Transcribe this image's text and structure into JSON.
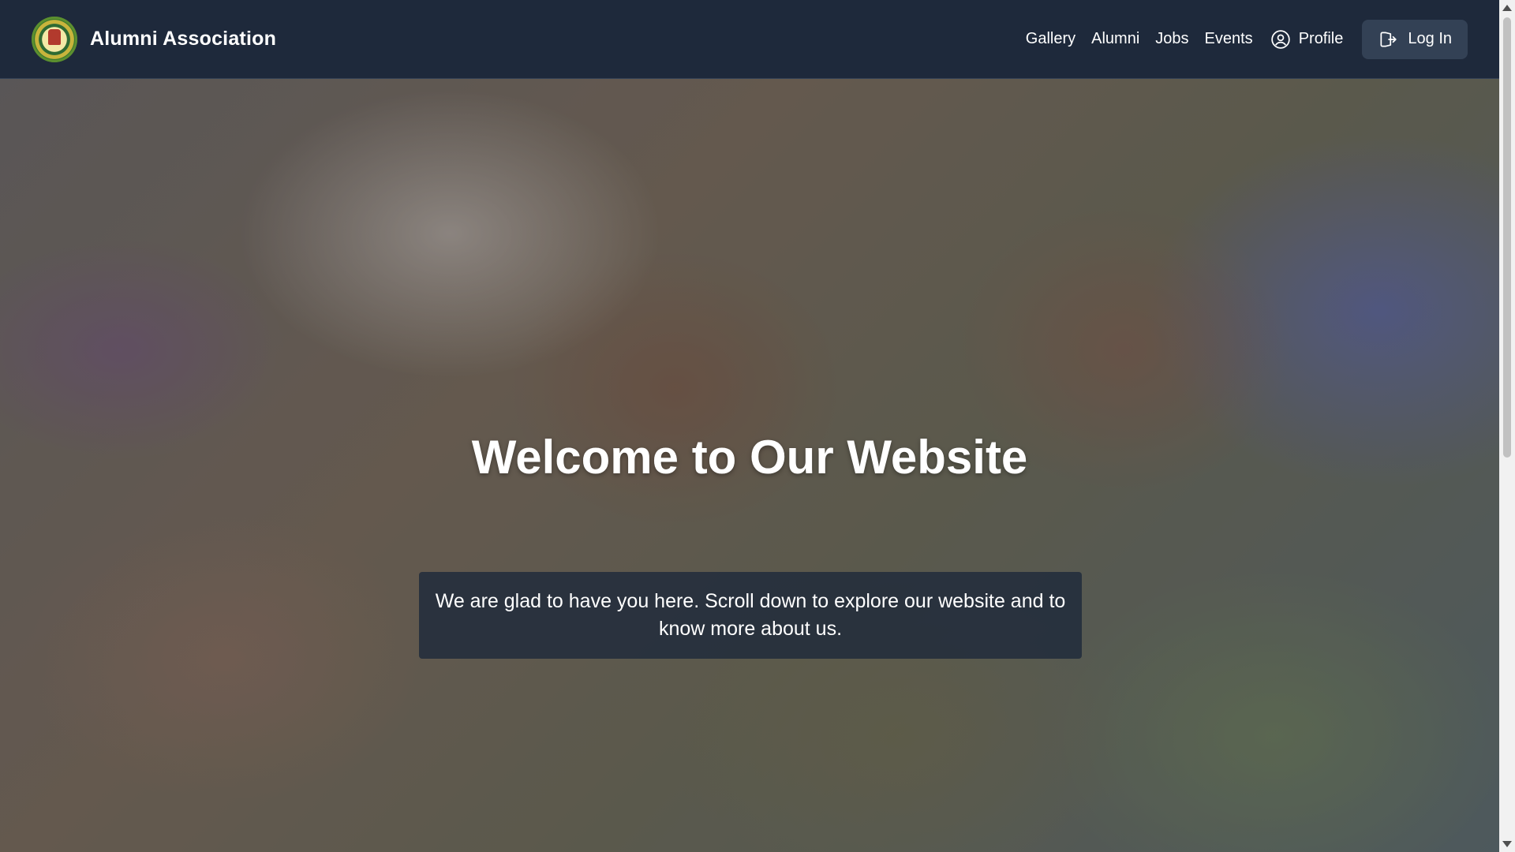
{
  "header": {
    "brand_name": "Alumni Association",
    "nav": [
      {
        "label": "Gallery"
      },
      {
        "label": "Alumni"
      },
      {
        "label": "Jobs"
      },
      {
        "label": "Events"
      }
    ],
    "profile_label": "Profile",
    "login_label": "Log In"
  },
  "hero": {
    "title": "Welcome to Our Website",
    "text": "We are glad to have you here. Scroll down to explore our website and to know more about us."
  },
  "icons": {
    "profile": "user-circle-icon",
    "login": "login-icon",
    "logo": "association-logo"
  },
  "colors": {
    "navbar": "#1e293b",
    "button": "#334155",
    "text": "#ffffff"
  }
}
